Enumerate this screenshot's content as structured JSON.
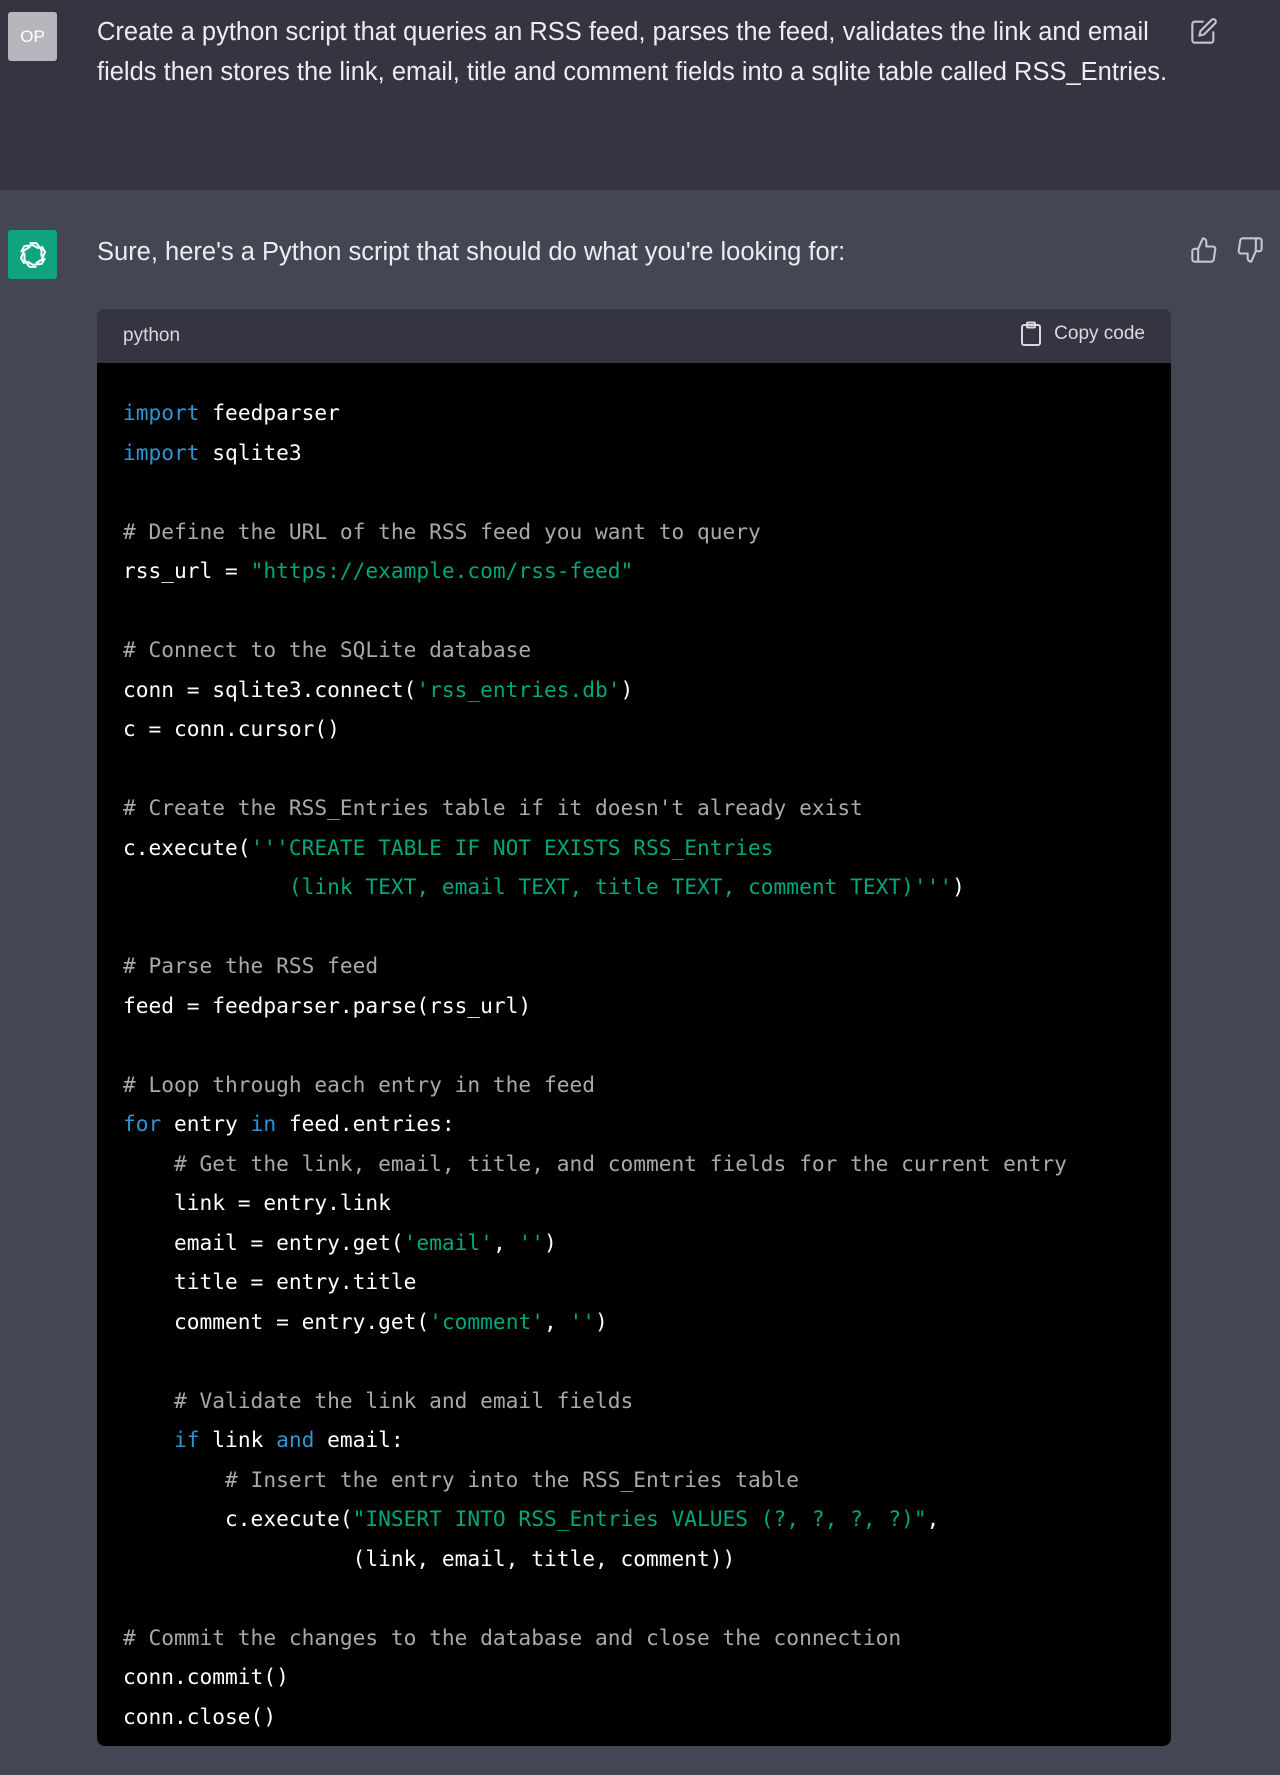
{
  "user": {
    "avatar_initials": "OP",
    "message": "Create a python script that queries an RSS feed, parses the feed, validates the link and email fields then stores the link, email, title and comment fields into a sqlite table called RSS_Entries.",
    "edit_icon": "edit-icon"
  },
  "assistant": {
    "avatar_icon": "openai-logo-icon",
    "intro": "Sure, here's a Python script that should do what you're looking for:",
    "feedback_icons": [
      "thumb-up-icon",
      "thumb-down-icon"
    ]
  },
  "code_block": {
    "language": "python",
    "copy_label": "Copy code",
    "lines": [
      [
        [
          "kw",
          "import"
        ],
        [
          "p",
          " feedparser"
        ]
      ],
      [
        [
          "kw",
          "import"
        ],
        [
          "p",
          " sqlite3"
        ]
      ],
      [],
      [
        [
          "cm",
          "# Define the URL of the RSS feed you want to query"
        ]
      ],
      [
        [
          "p",
          "rss_url = "
        ],
        [
          "st",
          "\"https://example.com/rss-feed\""
        ]
      ],
      [],
      [
        [
          "cm",
          "# Connect to the SQLite database"
        ]
      ],
      [
        [
          "p",
          "conn = sqlite3.connect("
        ],
        [
          "st",
          "'rss_entries.db'"
        ],
        [
          "p",
          ")"
        ]
      ],
      [
        [
          "p",
          "c = conn.cursor()"
        ]
      ],
      [],
      [
        [
          "cm",
          "# Create the RSS_Entries table if it doesn't already exist"
        ]
      ],
      [
        [
          "p",
          "c.execute("
        ],
        [
          "st",
          "'''CREATE TABLE IF NOT EXISTS RSS_Entries"
        ]
      ],
      [
        [
          "st",
          "             (link TEXT, email TEXT, title TEXT, comment TEXT)'''"
        ],
        [
          "p",
          ")"
        ]
      ],
      [],
      [
        [
          "cm",
          "# Parse the RSS feed"
        ]
      ],
      [
        [
          "p",
          "feed = feedparser.parse(rss_url)"
        ]
      ],
      [],
      [
        [
          "cm",
          "# Loop through each entry in the feed"
        ]
      ],
      [
        [
          "kw",
          "for"
        ],
        [
          "p",
          " entry "
        ],
        [
          "kw",
          "in"
        ],
        [
          "p",
          " feed.entries:"
        ]
      ],
      [
        [
          "cm",
          "    # Get the link, email, title, and comment fields for the current entry"
        ]
      ],
      [
        [
          "p",
          "    link = entry.link"
        ]
      ],
      [
        [
          "p",
          "    email = entry.get("
        ],
        [
          "st",
          "'email'"
        ],
        [
          "p",
          ", "
        ],
        [
          "st",
          "''"
        ],
        [
          "p",
          ")"
        ]
      ],
      [
        [
          "p",
          "    title = entry.title"
        ]
      ],
      [
        [
          "p",
          "    comment = entry.get("
        ],
        [
          "st",
          "'comment'"
        ],
        [
          "p",
          ", "
        ],
        [
          "st",
          "''"
        ],
        [
          "p",
          ")"
        ]
      ],
      [],
      [
        [
          "cm",
          "    # Validate the link and email fields"
        ]
      ],
      [
        [
          "kw",
          "    if"
        ],
        [
          "p",
          " link "
        ],
        [
          "kw",
          "and"
        ],
        [
          "p",
          " email:"
        ]
      ],
      [
        [
          "cm",
          "        # Insert the entry into the RSS_Entries table"
        ]
      ],
      [
        [
          "p",
          "        c.execute("
        ],
        [
          "st",
          "\"INSERT INTO RSS_Entries VALUES (?, ?, ?, ?)\""
        ],
        [
          "p",
          ","
        ]
      ],
      [
        [
          "p",
          "                  (link, email, title, comment))"
        ]
      ],
      [],
      [
        [
          "cm",
          "# Commit the changes to the database and close the connection"
        ]
      ],
      [
        [
          "p",
          "conn.commit()"
        ]
      ],
      [
        [
          "p",
          "conn.close()"
        ]
      ]
    ]
  },
  "colors": {
    "user_bg": "#343541",
    "assistant_bg": "#444654",
    "code_bg": "#000000",
    "keyword": "#2e95d3",
    "string": "#00a67d",
    "comment": "#a9a9a9",
    "bot_avatar": "#10a37f"
  }
}
